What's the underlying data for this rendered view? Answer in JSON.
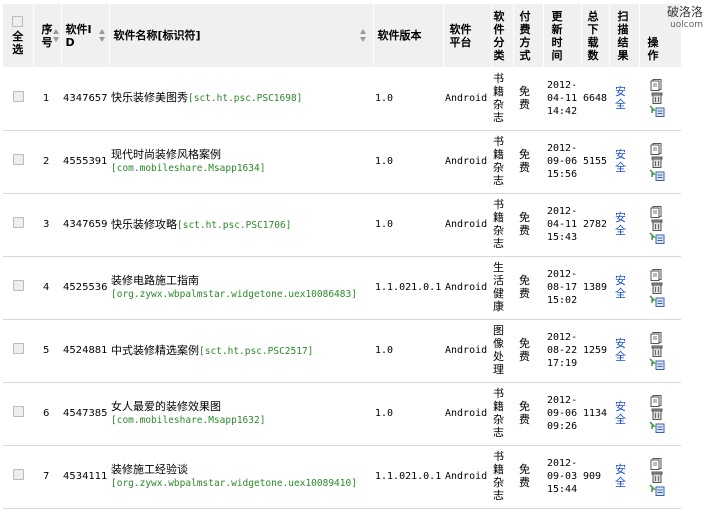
{
  "header": {
    "select_all": "全选",
    "index": "序号",
    "software_id": "软件ID",
    "software_name": "软件名称[标识符]",
    "version": "软件版本",
    "platform": "软件平台",
    "category": "软件分类",
    "payment": "付费方式",
    "update_time": "更新时间",
    "downloads": "总下载数",
    "scan_result": "扫描结果",
    "action": "操作"
  },
  "watermark": {
    "title": "破洛洛",
    "sub": "uolcom"
  },
  "rows": [
    {
      "index": "1",
      "id": "4347657",
      "name": "快乐装修美图秀",
      "identifier": "[sct.ht.psc.PSC1698]",
      "version": "1.0",
      "platform": "Android",
      "category": "书籍杂志",
      "payment": "免费",
      "date": "2012-04-11",
      "time": "14:42",
      "downloads": "6648",
      "scan": "安全"
    },
    {
      "index": "2",
      "id": "4555391",
      "name": "现代时尚装修风格案例",
      "identifier": "[com.mobileshare.Msapp1634]",
      "version": "1.0",
      "platform": "Android",
      "category": "书籍杂志",
      "payment": "免费",
      "date": "2012-09-06",
      "time": "15:56",
      "downloads": "5155",
      "scan": "安全"
    },
    {
      "index": "3",
      "id": "4347659",
      "name": "快乐装修攻略",
      "identifier": "[sct.ht.psc.PSC1706]",
      "version": "1.0",
      "platform": "Android",
      "category": "书籍杂志",
      "payment": "免费",
      "date": "2012-04-11",
      "time": "15:43",
      "downloads": "2782",
      "scan": "安全"
    },
    {
      "index": "4",
      "id": "4525536",
      "name": "装修电路施工指南",
      "identifier": "[org.zywx.wbpalmstar.widgetone.uex10086483]",
      "version": "1.1.021.0.1",
      "platform": "Android",
      "category": "生活健康",
      "payment": "免费",
      "date": "2012-08-17",
      "time": "15:02",
      "downloads": "1389",
      "scan": "安全"
    },
    {
      "index": "5",
      "id": "4524881",
      "name": "中式装修精选案例",
      "identifier": "[sct.ht.psc.PSC2517]",
      "version": "1.0",
      "platform": "Android",
      "category": "图像处理",
      "payment": "免费",
      "date": "2012-08-22",
      "time": "17:19",
      "downloads": "1259",
      "scan": "安全"
    },
    {
      "index": "6",
      "id": "4547385",
      "name": "女人最爱的装修效果图",
      "identifier": "[com.mobileshare.Msapp1632]",
      "version": "1.0",
      "platform": "Android",
      "category": "书籍杂志",
      "payment": "免费",
      "date": "2012-09-06",
      "time": "09:26",
      "downloads": "1134",
      "scan": "安全"
    },
    {
      "index": "7",
      "id": "4534111",
      "name": "装修施工经验谈",
      "identifier": "[org.zywx.wbpalmstar.widgetone.uex10089410]",
      "version": "1.1.021.0.1",
      "platform": "Android",
      "category": "书籍杂志",
      "payment": "免费",
      "date": "2012-09-03",
      "time": "15:44",
      "downloads": "909",
      "scan": "安全"
    }
  ]
}
